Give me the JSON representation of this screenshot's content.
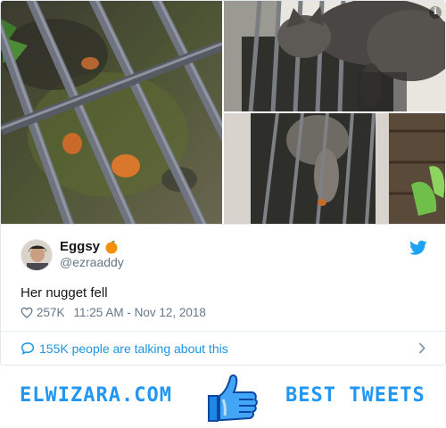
{
  "tweet": {
    "author_name": "Eggsy",
    "author_emoji": "orange-emoji",
    "author_handle": "@ezraaddy",
    "text": "Her nugget fell",
    "likes": "257K",
    "timestamp": "11:25 AM - Nov 12, 2018"
  },
  "conversation": {
    "text": "155K people are talking about this"
  },
  "banner": {
    "left_text": "ELWIZARA.COM",
    "right_text": "BEST TWEETS"
  },
  "colors": {
    "twitter_blue": "#1da1f2",
    "link_blue": "#1b95e0",
    "brand_blue": "#2196f3",
    "muted_text": "#657786"
  },
  "icons": {
    "info": "info-icon",
    "brand": "twitter-bird-icon",
    "likes": "heart-icon",
    "conversation": "speech-bubble-icon",
    "more": "chevron-right-icon",
    "banner_center": "thumbs-up-icon"
  }
}
